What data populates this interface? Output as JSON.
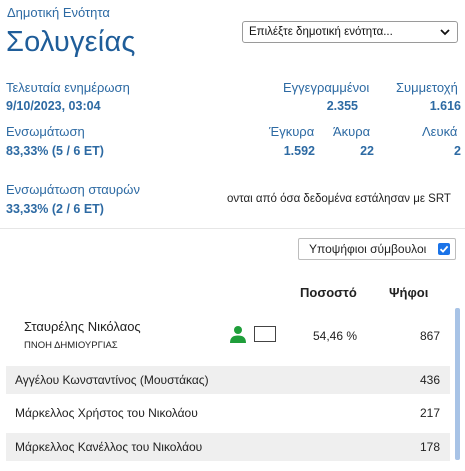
{
  "header": {
    "label": "Δημοτική Ενότητα",
    "name": "Σολυγείας",
    "select": {
      "value": "Επιλέξτε δημοτική ενότητα..."
    }
  },
  "stats": {
    "last_update_label": "Τελευταία ενημέρωση",
    "last_update_value": "9/10/2023, 03:04",
    "registered_label": "Εγγεγραμμένοι",
    "registered_value": "2.355",
    "turnout_label": "Συμμετοχή",
    "turnout_value": "1.616",
    "integration_label": "Ενσωμάτωση",
    "integration_value": "83,33% (5 / 6 ΕΤ)",
    "valid_label": "Έγκυρα",
    "valid_value": "1.592",
    "invalid_label": "Άκυρα",
    "invalid_value": "22",
    "blank_label": "Λευκά",
    "blank_value": "2",
    "cross_integration_label": "Ενσωμάτωση σταυρών",
    "cross_integration_value": "33,33% (2 / 6 ΕΤ)",
    "scroll_note": "ονται από όσα δεδομένα εστάλησαν με SRT"
  },
  "candidates_toggle": {
    "label": "Υποψήφιοι σύμβουλοι",
    "checked": true
  },
  "table": {
    "headers": {
      "percent": "Ποσοστό",
      "votes": "Ψήφοι"
    },
    "leader": {
      "name": "Σταυρέλης Νικόλαος",
      "party": "ΠΝΟΗ ΔΗΜΙΟΥΡΓΙΑΣ",
      "percent": "54,46 %",
      "votes": "867"
    },
    "rows": [
      {
        "name": "Αγγέλου Κωνσταντίνος (Μουστάκας)",
        "votes": "436"
      },
      {
        "name": "Μάρκελλος Χρήστος του Νικολάου",
        "votes": "217"
      },
      {
        "name": "Μάρκελλος Κανέλλος του Νικολάου",
        "votes": "178"
      }
    ]
  },
  "colors": {
    "accent": "#2d6aa3",
    "icon_green": "#1f9e3a",
    "checkbox": "#1a73e8"
  }
}
